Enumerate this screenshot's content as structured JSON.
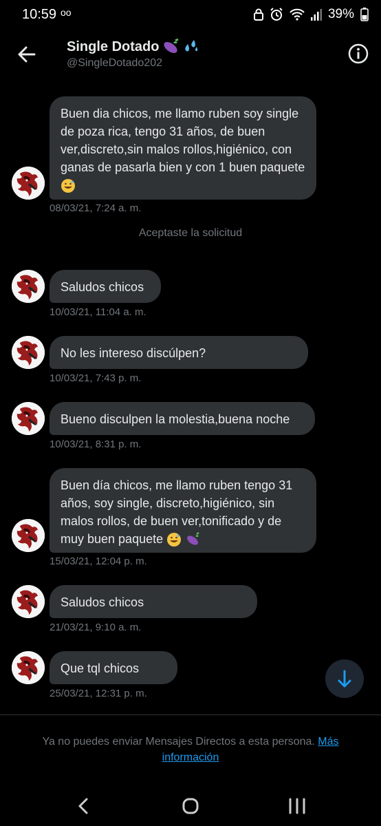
{
  "status_bar": {
    "time": "10:59",
    "voicemail": "oo",
    "battery": "39%"
  },
  "header": {
    "title": "Single Dotado",
    "handle": "@SingleDotado202"
  },
  "messages": [
    {
      "text": "Buen dia chicos, me llamo ruben soy single de poza rica, tengo 31 años, de buen ver,discreto,sin malos rollos,higiénico, con ganas de pasarla bien y con 1 buen paquete",
      "time": "08/03/21, 7:24 a. m."
    },
    {
      "text": "Saludos chicos",
      "time": "10/03/21, 11:04 a. m."
    },
    {
      "text": "No les intereso discúlpen?",
      "time": "10/03/21, 7:43 p. m."
    },
    {
      "text": "Bueno disculpen la molestia,buena noche",
      "time": "10/03/21, 8:31 p. m."
    },
    {
      "text": "Buen día chicos, me llamo ruben tengo 31 años, soy single, discreto,higiénico, sin malos rollos, de buen ver,tonificado y de muy buen paquete",
      "time": "15/03/21, 12:04 p. m."
    },
    {
      "text": "Saludos chicos",
      "time": "21/03/21, 9:10 a. m."
    },
    {
      "text": "Que tql chicos",
      "time": "25/03/21, 12:31 p. m."
    }
  ],
  "system_message": "Aceptaste la solicitud",
  "footer": {
    "notice": "Ya no puedes enviar Mensajes Directos a esta persona.",
    "link": "Más información"
  },
  "icons": {
    "back": "arrow-left-icon",
    "info": "info-icon",
    "scroll": "arrow-down-icon",
    "nav": [
      "nav-back-icon",
      "nav-home-icon",
      "nav-recents-icon"
    ]
  },
  "colors": {
    "accent": "#1d9bf0",
    "bubble": "#2f3336",
    "background": "#000000",
    "muted": "#71767b"
  }
}
